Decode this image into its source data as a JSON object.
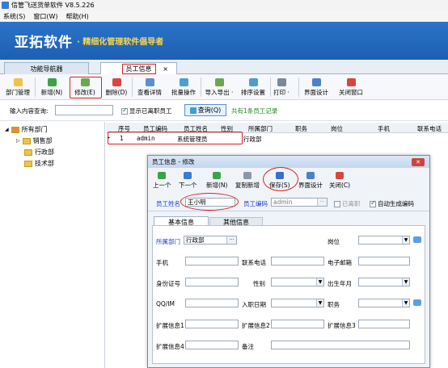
{
  "app": {
    "title": "信管飞送货单软件 V8.5.226"
  },
  "menu": [
    "系统(S)",
    "窗口(W)",
    "帮助(H)"
  ],
  "banner": {
    "logo": "亚拓软件",
    "slogan": "· 精细化管理软件倡导者"
  },
  "tabs": [
    {
      "label": "功能导航器"
    },
    {
      "label": "员工信息",
      "close": "×"
    }
  ],
  "toolbar": [
    {
      "label": "部门管理",
      "icon": "folder-icon",
      "color": "#f0c24a"
    },
    {
      "label": "新增(N)",
      "icon": "add-icon",
      "color": "#3aa346"
    },
    {
      "label": "修改(E)",
      "icon": "edit-icon",
      "color": "#6aa84f"
    },
    {
      "label": "删除(D)",
      "icon": "delete-icon",
      "color": "#d9463d"
    },
    {
      "label": "查看详情",
      "icon": "detail-icon",
      "color": "#5b8fd0"
    },
    {
      "label": "批量操作",
      "icon": "batch-icon",
      "color": "#4a9fd0"
    },
    {
      "label": "导入导出 ·",
      "icon": "import-export-icon",
      "color": "#6aa84f"
    },
    {
      "label": "排序设置",
      "icon": "sort-icon",
      "color": "#4aa0c8"
    },
    {
      "label": "打印 ·",
      "icon": "print-icon",
      "color": "#7a8a9a"
    },
    {
      "label": "界面设计",
      "icon": "design-icon",
      "color": "#4a82c8"
    },
    {
      "label": "关闭窗口",
      "icon": "close-window-icon",
      "color": "#d9463d"
    }
  ],
  "search": {
    "label": "输入内容查询:",
    "value": "",
    "show_resigned": "显示已离职员工",
    "query_button": "查询(Q)",
    "count_text": "共有1条员工记录"
  },
  "tree": {
    "root": "所有部门",
    "children": [
      "销售部",
      "行政部",
      "技术部"
    ]
  },
  "grid": {
    "headers": [
      "序号",
      "员工编码",
      "员工姓名",
      "性别",
      "所属部门",
      "职务",
      "岗位",
      "手机",
      "联系电话"
    ],
    "rows": [
      {
        "marker": "▸",
        "index": "1",
        "code": "admin",
        "name": "系统管理员",
        "gender": "",
        "dept": "行政部",
        "title": "",
        "post": "",
        "mobile": "",
        "phone": ""
      }
    ]
  },
  "dialog": {
    "title": "员工信息 - 修改",
    "close": "✕",
    "toolbar": [
      {
        "label": "上一个",
        "icon": "prev-icon",
        "color": "#3aa346"
      },
      {
        "label": "下一个",
        "icon": "next-icon",
        "color": "#3a7bd5"
      },
      {
        "label": "新增(N)",
        "icon": "add-icon",
        "color": "#3aa346"
      },
      {
        "label": "复制新增",
        "icon": "copy-icon",
        "color": "#8a98a8"
      },
      {
        "label": "保存(S)",
        "icon": "save-icon",
        "color": "#3a6fc8"
      },
      {
        "label": "界面设计",
        "icon": "design-icon",
        "color": "#4a82c8"
      },
      {
        "label": "关闭(C)",
        "icon": "close-icon",
        "color": "#d9463d"
      }
    ],
    "name_label": "员工姓名",
    "name_value": "王小明",
    "code_label": "员工编码",
    "code_value": "admin",
    "code_btn": "···",
    "resigned_label": "已离职",
    "autocode_label": "自动生成编码",
    "tabs": [
      "基本信息",
      "其他信息"
    ],
    "fields": {
      "dept_label": "所属部门",
      "dept_value": "行政部",
      "dept_btn": "···",
      "position_label": "岗位",
      "mobile_label": "手机",
      "phone_label": "联系电话",
      "email_label": "电子邮箱",
      "id_label": "身份证号",
      "gender_label": "性别",
      "birth_label": "出生年月",
      "qq_label": "QQ/IM",
      "hire_label": "入职日期",
      "duty_label": "职务",
      "ext1_label": "扩展信息1",
      "ext2_label": "扩展信息2",
      "ext3_label": "扩展信息3",
      "ext4_label": "扩展信息4",
      "note_label": "备注"
    },
    "dropdown_arrow": "▼"
  }
}
